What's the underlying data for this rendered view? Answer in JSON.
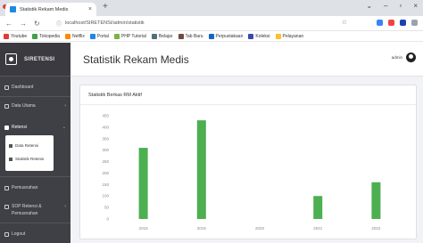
{
  "browser": {
    "tab_title": "Statistik Rekam Medis",
    "url": "localhost/SIRETENSI/admin/statistik",
    "colors": {
      "ext1": "#3b82f6",
      "ext2": "#ef4444",
      "ext3": "#1e40af",
      "ext4": "#9ca3af"
    },
    "bookmarks": [
      {
        "label": "Youtube",
        "color": "#e53935"
      },
      {
        "label": "Tokopedia",
        "color": "#43a047"
      },
      {
        "label": "Netflix",
        "color": "#fb8c00"
      },
      {
        "label": "Portal",
        "color": "#1e88e5"
      },
      {
        "label": "PHP Tutorial",
        "color": "#7cb342"
      },
      {
        "label": "Belajar",
        "color": "#546e7a"
      },
      {
        "label": "Tab Baru",
        "color": "#6d4c41"
      },
      {
        "label": "Perpustakaan",
        "color": "#1565c0"
      },
      {
        "label": "Koleksi",
        "color": "#3949ab"
      },
      {
        "label": "Pelayanan",
        "color": "#fbc02d"
      }
    ]
  },
  "sidebar": {
    "brand": "SIRETENSI",
    "items": [
      {
        "label": "Dashboard"
      },
      {
        "label": "Data Utama"
      },
      {
        "label": "Retensi"
      },
      {
        "label": "Pemusnahan"
      },
      {
        "label": "SOP Retensi &",
        "label2": "Pemusnahan"
      },
      {
        "label": "Logout"
      }
    ],
    "submenu": [
      {
        "label": "Data Retensi"
      },
      {
        "label": "Statistik Retensi"
      }
    ]
  },
  "header": {
    "title": "Statistik Rekam Medis",
    "user_name": "admin"
  },
  "card": {
    "title": "Statistik Berkas RM Aktif"
  },
  "chart_data": {
    "type": "bar",
    "categories": [
      "2018",
      "2019",
      "2020",
      "2021",
      "2022"
    ],
    "values": [
      310,
      430,
      0,
      100,
      160
    ],
    "ylim": [
      0,
      450
    ],
    "yticks": [
      0,
      50,
      100,
      150,
      200,
      250,
      300,
      350,
      400,
      450
    ],
    "bar_color": "#4caf50",
    "grid": false
  }
}
